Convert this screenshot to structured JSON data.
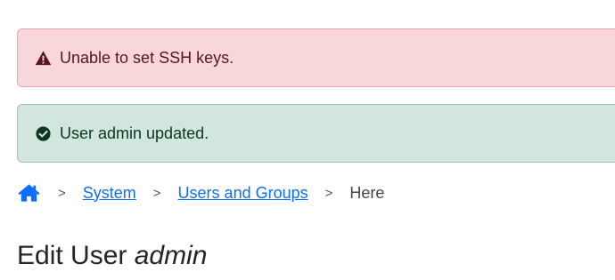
{
  "alerts": {
    "error": {
      "message": "Unable to set SSH keys.",
      "icon": "warning-triangle-icon",
      "color": "#58151c",
      "background": "#f8d7da"
    },
    "success": {
      "message": "User admin updated.",
      "icon": "check-circle-icon",
      "color": "#0a3622",
      "background": "#d1e7dd"
    }
  },
  "breadcrumb": {
    "home_icon": "home-icon",
    "separator": ">",
    "items": [
      {
        "label": "System"
      },
      {
        "label": "Users and Groups"
      }
    ],
    "current": "Here",
    "link_color": "#0d6efd"
  },
  "page": {
    "title_prefix": "Edit User",
    "title_user": "admin"
  }
}
